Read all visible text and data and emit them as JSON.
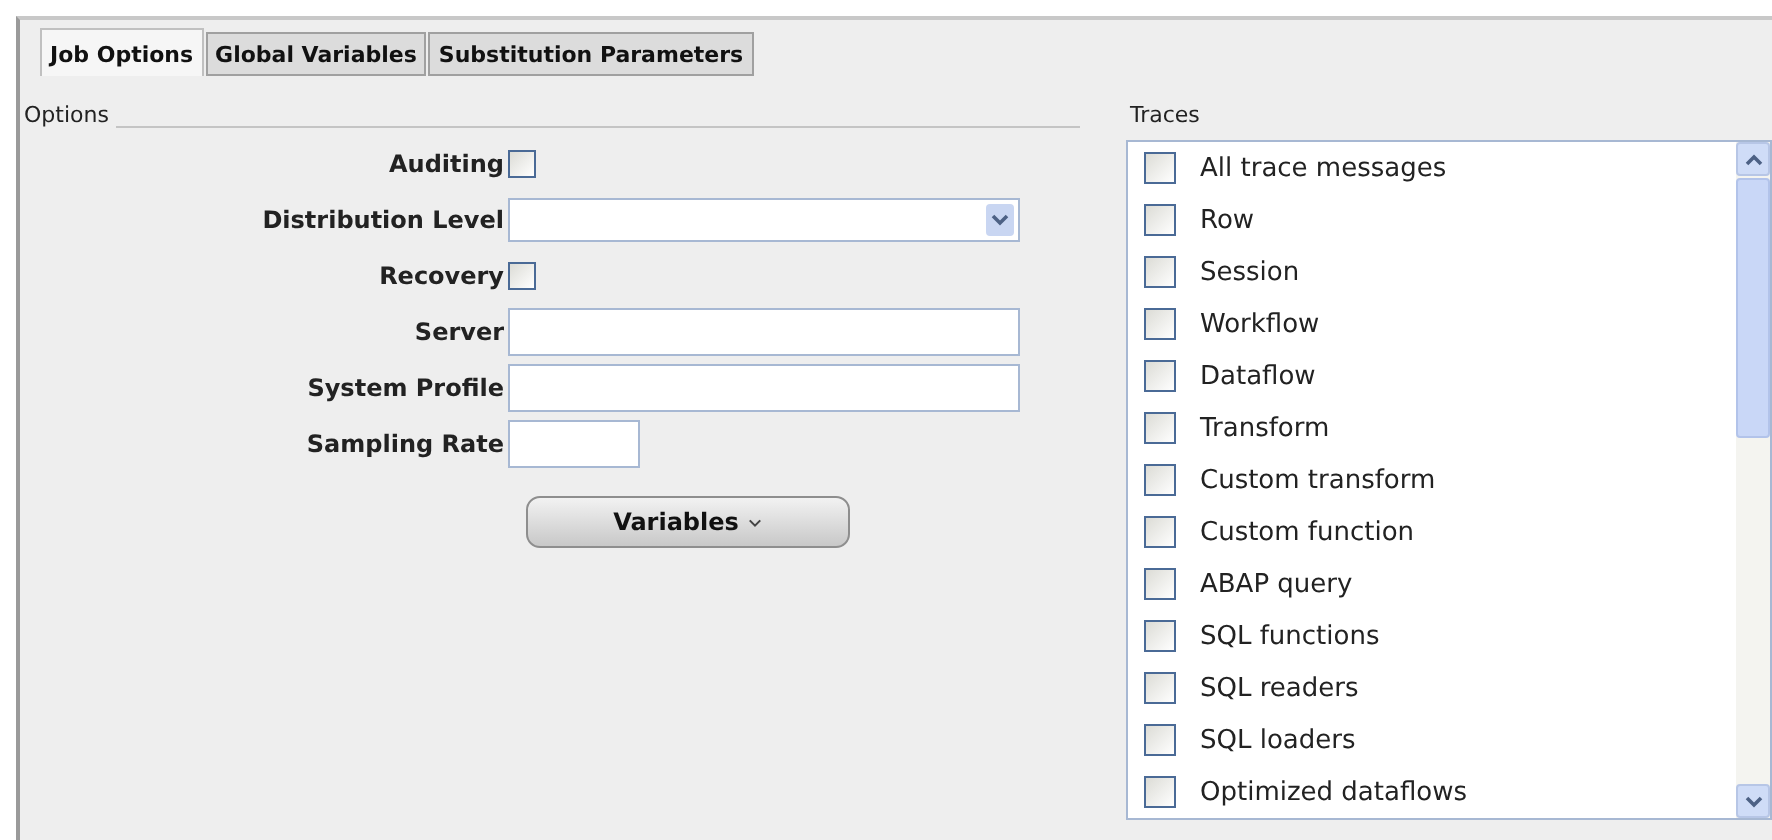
{
  "tabs": [
    {
      "label": "Job Options",
      "selected": true
    },
    {
      "label": "Global Variables",
      "selected": false
    },
    {
      "label": "Substitution Parameters",
      "selected": false
    }
  ],
  "options": {
    "heading": "Options",
    "fields": [
      {
        "kind": "checkbox",
        "label": "Auditing",
        "checked": false
      },
      {
        "kind": "dropdown",
        "label": "Distribution Level"
      },
      {
        "kind": "checkbox",
        "label": "Recovery",
        "checked": false
      },
      {
        "kind": "text",
        "label": "Server"
      },
      {
        "kind": "text",
        "label": "System Profile"
      },
      {
        "kind": "short",
        "label": "Sampling Rate"
      }
    ],
    "button": "Variables"
  },
  "traces": {
    "heading": "Traces",
    "items": [
      {
        "label": "All trace messages",
        "checked": false
      },
      {
        "label": "Row",
        "checked": false
      },
      {
        "label": "Session",
        "checked": false
      },
      {
        "label": "Workflow",
        "checked": false
      },
      {
        "label": "Dataflow",
        "checked": false
      },
      {
        "label": "Transform",
        "checked": false
      },
      {
        "label": "Custom transform",
        "checked": false
      },
      {
        "label": "Custom function",
        "checked": false
      },
      {
        "label": "ABAP query",
        "checked": false
      },
      {
        "label": "SQL functions",
        "checked": false
      },
      {
        "label": "SQL readers",
        "checked": false
      },
      {
        "label": "SQL loaders",
        "checked": false
      },
      {
        "label": "Optimized dataflows",
        "checked": false
      }
    ]
  }
}
